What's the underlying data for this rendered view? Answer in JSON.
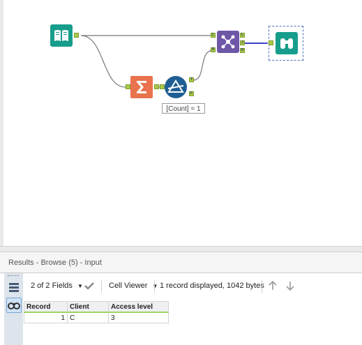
{
  "results": {
    "title": "Results - Browse (5) - Input",
    "fields_label": "2 of 2 Fields",
    "viewer_label": "Cell Viewer",
    "status": "1 record displayed, 1042 bytes",
    "columns": [
      "Record",
      "Client",
      "Access level"
    ],
    "rows": [
      [
        "1",
        "C",
        "3"
      ]
    ]
  },
  "workflow": {
    "formula_label": "[Count] = 1",
    "anchors": {
      "left": "L",
      "right": "R",
      "join": "J",
      "true": "T",
      "false": "F"
    }
  },
  "icons": [
    "book-icon",
    "sigma-icon",
    "filter-icon",
    "join-icon",
    "binoculars-icon",
    "checkmark-icon",
    "arrow-up-icon",
    "arrow-down-icon",
    "grid-icon"
  ],
  "colors": {
    "input_tool": "#179d8b",
    "summarize_tool": "#e8734c",
    "filter_tool": "#1f5e94",
    "join_tool": "#6e57a7",
    "browse_tool": "#179d8b",
    "anchor": "#a9c94a",
    "selected_connection": "#3b3fcf"
  }
}
